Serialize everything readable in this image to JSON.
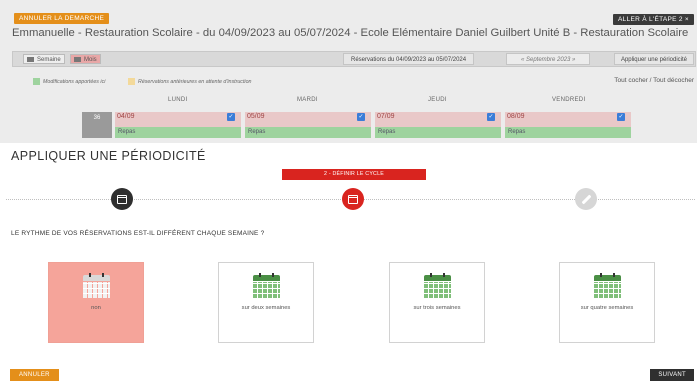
{
  "header": {
    "cancel_button": "ANNULER LA DEMARCHE",
    "back_button": "ALLER À L'ÉTAPE 2 ×",
    "title": "Emmanuelle - Restauration Scolaire - du 04/09/2023 au 05/07/2024 - Ecole Elémentaire Daniel Guilbert Unité B - Restauration Scolaire"
  },
  "toolbar": {
    "week_label": "Semaine",
    "month_label": "Mois",
    "range_label": "Réservations du 04/09/2023 au 05/07/2024",
    "month_nav": "« Septembre 2023 »",
    "apply_periodicity": "Appliquer une périodicité"
  },
  "legend": {
    "item1": "Modifications apportées ici",
    "item1_color": "#9ed39e",
    "item2": "Réservations antérieures en attente d'instruction",
    "item2_color": "#f3d99a"
  },
  "select_links": "Tout cocher  /  Tout décocher",
  "calendar": {
    "days": [
      "LUNDI",
      "MARDI",
      "JEUDI",
      "VENDREDI"
    ],
    "week_number": "36",
    "cells": [
      {
        "date": "04/09",
        "meal": "Repas"
      },
      {
        "date": "05/09",
        "meal": "Repas"
      },
      {
        "date": "07/09",
        "meal": "Repas"
      },
      {
        "date": "08/09",
        "meal": "Repas"
      }
    ]
  },
  "modal": {
    "title": "APPLIQUER UNE PÉRIODICITÉ",
    "step_label": "2 - DÉFINIR LE CYCLE",
    "steps": [
      {
        "icon": "calendar-icon",
        "state": "done"
      },
      {
        "icon": "calendar-icon",
        "state": "active"
      },
      {
        "icon": "pencil-icon",
        "state": "todo"
      }
    ],
    "question": "LE RYTHME DE VOS RÉSERVATIONS EST-IL DIFFÉRENT CHAQUE SEMAINE ?",
    "options": [
      {
        "label": "non",
        "selected": true
      },
      {
        "label": "sur deux semaines",
        "selected": false
      },
      {
        "label": "sur trois semaines",
        "selected": false
      },
      {
        "label": "sur quatre semaines",
        "selected": false
      }
    ],
    "cancel_button": "ANNULER",
    "next_button": "SUIVANT",
    "accent_color": "#d9241f",
    "selected_color": "#f5a49a"
  }
}
